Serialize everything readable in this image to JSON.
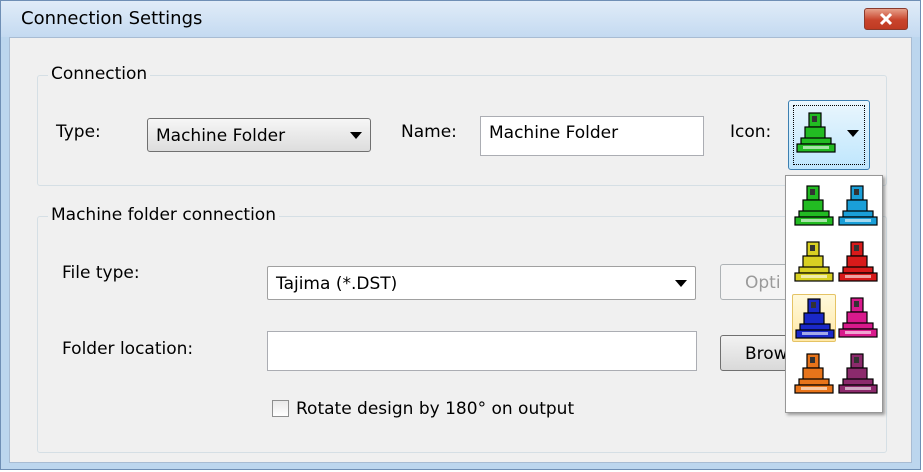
{
  "window": {
    "title": "Connection Settings"
  },
  "connection_group": {
    "label": "Connection",
    "type_label": "Type:",
    "type_value": "Machine Folder",
    "name_label": "Name:",
    "name_value": "Machine Folder",
    "icon_label": "Icon:",
    "selected_icon_color": "#22bb22"
  },
  "machine_folder_group": {
    "label": "Machine folder connection",
    "file_type_label": "File type:",
    "file_type_value": "Tajima (*.DST)",
    "options_button": "Opti",
    "folder_location_label": "Folder location:",
    "folder_location_value": "",
    "browse_button": "Brow",
    "rotate_label": "Rotate design by 180° on output",
    "rotate_checked": false
  },
  "icon_palette": {
    "colors": [
      "#22bb22",
      "#1a9fd8",
      "#d8d022",
      "#d81a1a",
      "#1a28c8",
      "#d81a8c",
      "#e8741a",
      "#8c2a6c"
    ],
    "selected_index": 4
  }
}
